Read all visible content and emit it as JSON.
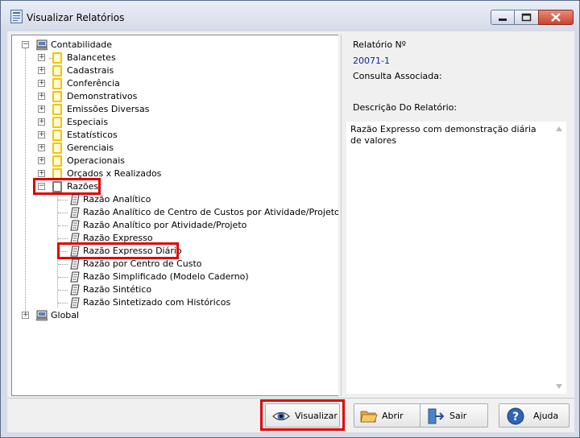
{
  "window": {
    "title": "Visualizar Relatórios"
  },
  "tree": {
    "root": "Contabilidade",
    "categories": [
      "Balancetes",
      "Cadastrais",
      "Conferência",
      "Demonstrativos",
      "Emissões Diversas",
      "Especiais",
      "Estatísticos",
      "Gerenciais",
      "Operacionais",
      "Orçados x Realizados"
    ],
    "expanded": "Razões",
    "reports": [
      "Razão Analítico",
      "Razão Analítico de Centro de Custos por Atividade/Projeto",
      "Razão Analítico por Atividade/Projeto",
      "Razão Expresso",
      "Razão Expresso Diário",
      "Razão por Centro de Custo",
      "Razão Simplificado (Modelo Caderno)",
      "Razão Sintético",
      "Razão Sintetizado com Históricos"
    ],
    "selected_report": "Razão Expresso Diário",
    "second_root": "Global"
  },
  "info": {
    "report_no_label": "Relatório Nº",
    "report_no_value": "20071-1",
    "assoc_label": "Consulta Associada:",
    "desc_label": "Descrição Do Relatório:",
    "desc_text": "Razão Expresso com demonstração diária de valores"
  },
  "buttons": {
    "visualizar": "Visualizar",
    "abrir": "Abrir",
    "sair": "Sair",
    "ajuda": "Ajuda"
  },
  "colors": {
    "highlight": "#e00000",
    "value_text": "#0a2a8a",
    "folder": "#f2c500"
  },
  "icons": {
    "minimize": "minimize-icon",
    "maximize": "maximize-icon",
    "close": "close-icon"
  }
}
